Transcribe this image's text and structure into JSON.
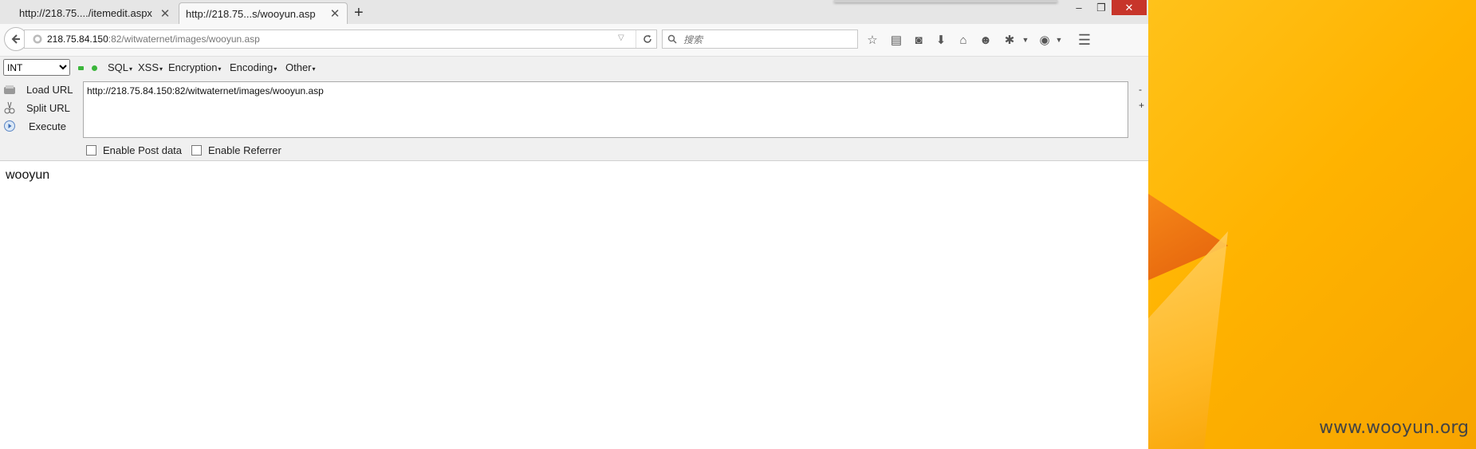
{
  "tabs": [
    {
      "label": "http://218.75..../itemedit.aspx",
      "close": "✕"
    },
    {
      "label": "http://218.75...s/wooyun.asp",
      "close": "✕"
    }
  ],
  "new_tab": "+",
  "window_controls": {
    "minimize": "–",
    "maximize": "❐",
    "close": "✕"
  },
  "url": {
    "host": "218.75.84.150",
    "path": ":82/witwaternet/images/wooyun.asp"
  },
  "search": {
    "placeholder": "搜索"
  },
  "hackbar": {
    "type_selected": "INT",
    "menus": [
      "SQL",
      "XSS",
      "Encryption",
      "Encoding",
      "Other"
    ],
    "load_url": "Load URL",
    "split_url": "Split URL",
    "execute": "Execute",
    "url_value": "http://218.75.84.150:82/witwaternet/images/wooyun.asp",
    "minus": "-",
    "plus": "+",
    "enable_post": "Enable Post data",
    "enable_referrer": "Enable Referrer"
  },
  "page_content": "wooyun",
  "watermark": "www.wooyun.org"
}
